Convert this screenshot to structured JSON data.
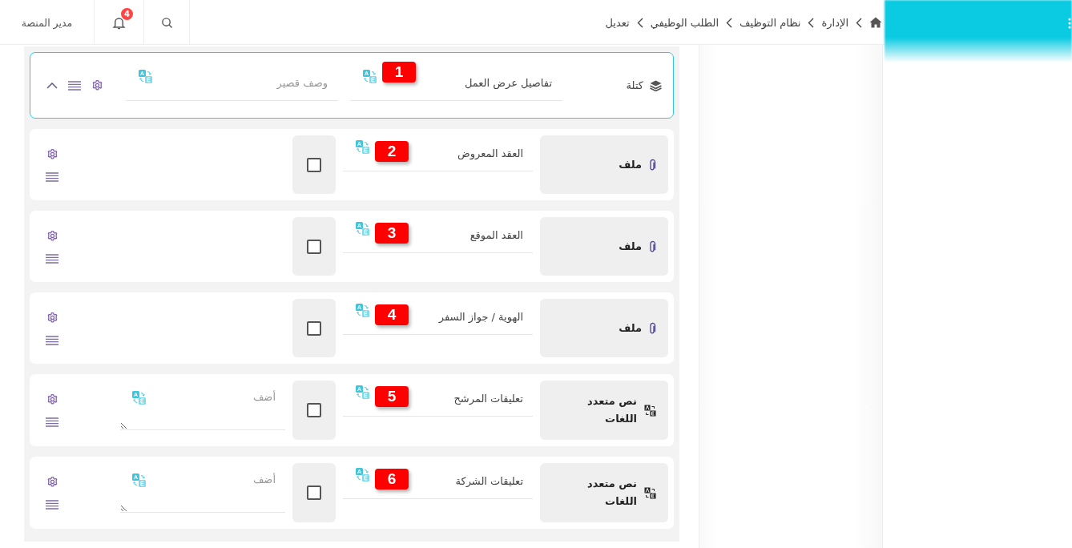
{
  "header": {
    "user_name": "مدير المنصة",
    "notifications_count": "4",
    "breadcrumb": [
      {
        "label": "الإدارة"
      },
      {
        "label": "نظام التوظيف"
      },
      {
        "label": "الطلب الوظيفي"
      },
      {
        "label": "تعديل"
      }
    ]
  },
  "block": {
    "type_label": "كتلة",
    "title": "تفاصيل عرض العمل",
    "marker": "1",
    "description_placeholder": "وصف قصير",
    "expanded": true
  },
  "fields": [
    {
      "kind": "file",
      "type_label": "ملف",
      "label": "العقد المعروض",
      "marker": "2",
      "checked": false
    },
    {
      "kind": "file",
      "type_label": "ملف",
      "label": "العقد الموقع",
      "marker": "3",
      "checked": false
    },
    {
      "kind": "file",
      "type_label": "ملف",
      "label": "الهوية / جواز السفر",
      "marker": "4",
      "checked": false
    },
    {
      "kind": "multilang",
      "type_label": "نص متعدد اللغات",
      "label": "تعليقات المرشح",
      "marker": "5",
      "checked": false,
      "placeholder": "أضف"
    },
    {
      "kind": "multilang",
      "type_label": "نص متعدد اللغات",
      "label": "تعليقات الشركة",
      "marker": "6",
      "checked": false,
      "placeholder": "أضف"
    }
  ]
}
